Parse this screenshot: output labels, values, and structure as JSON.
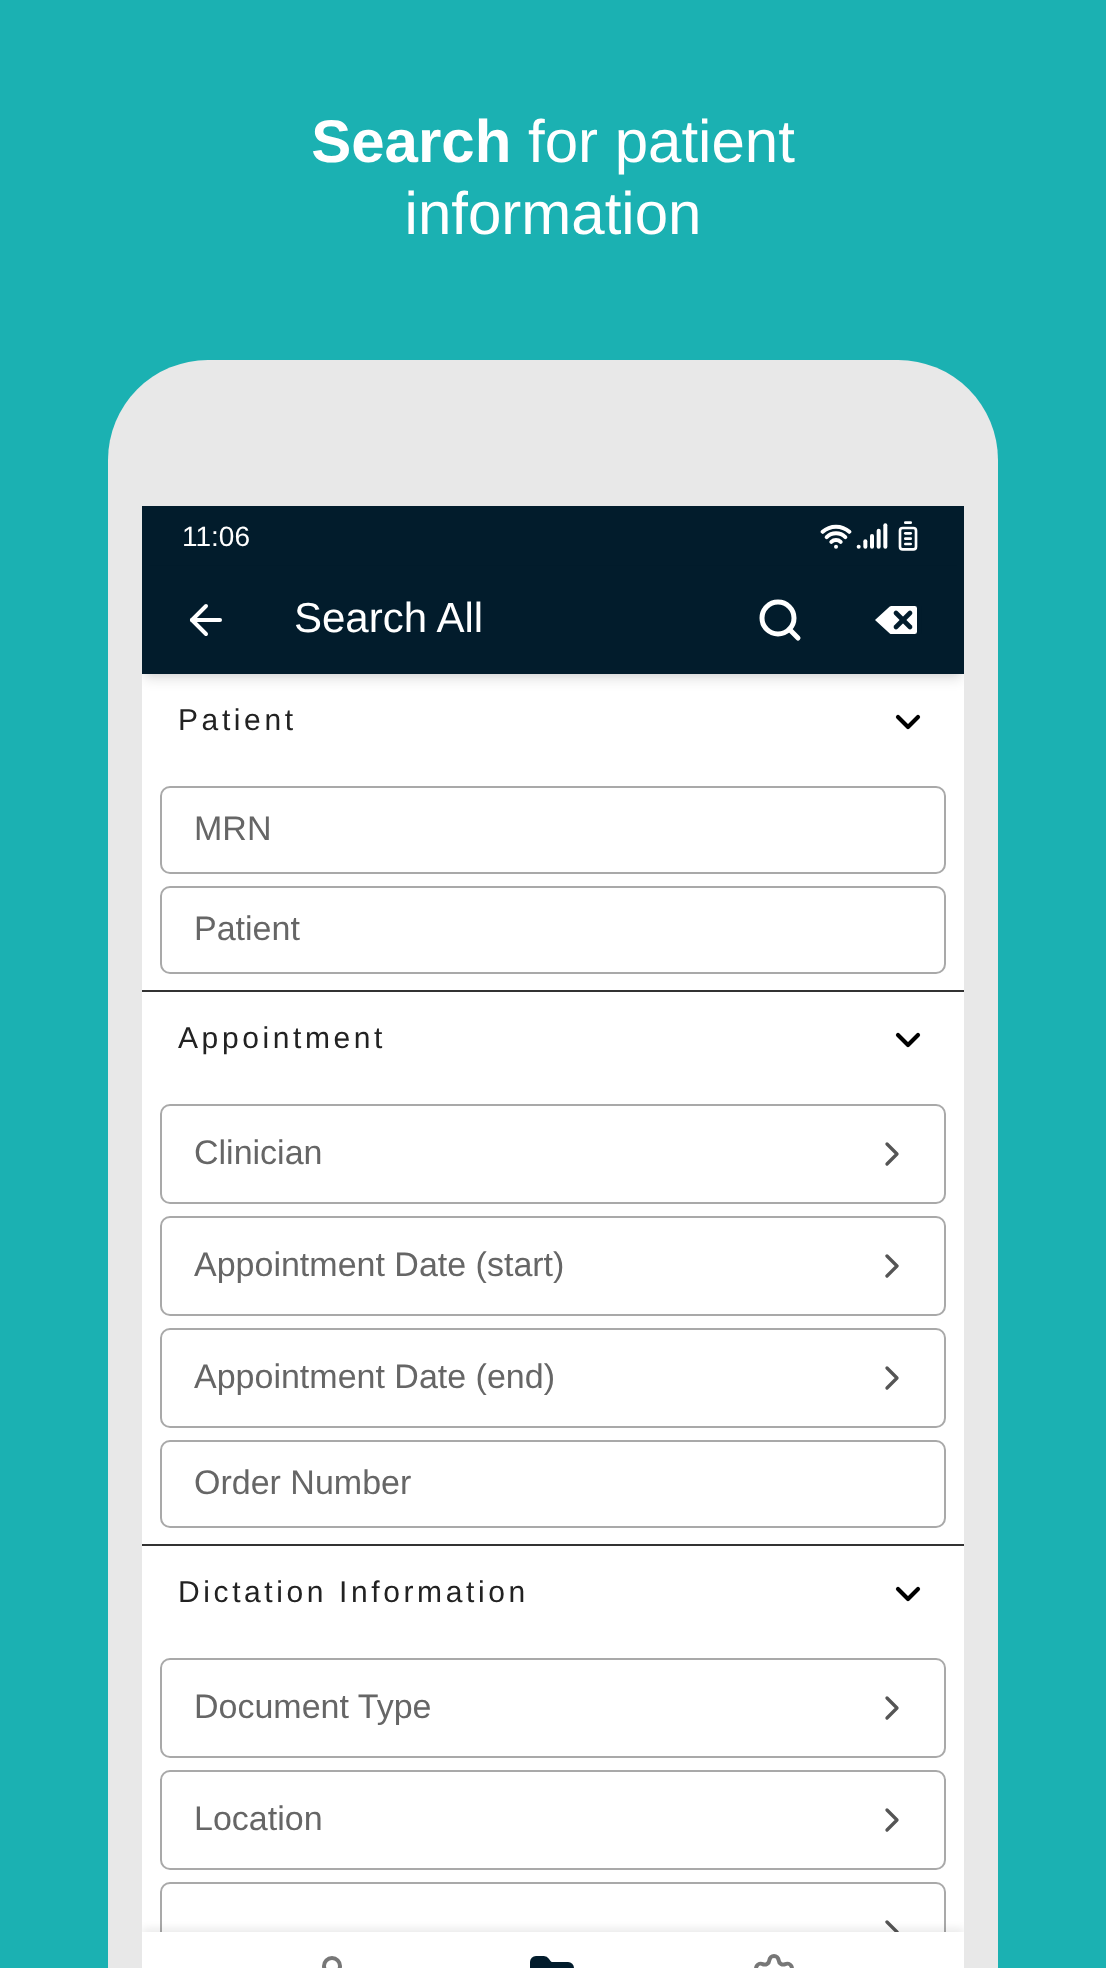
{
  "headline": "**Search** for patient information",
  "status_bar": {
    "time": "11:06"
  },
  "app_bar": {
    "title": "Search All"
  },
  "sections": [
    {
      "title": "Patient",
      "expanded": true,
      "fields": [
        {
          "kind": "text",
          "placeholder": "MRN"
        },
        {
          "kind": "text",
          "placeholder": "Patient"
        }
      ]
    },
    {
      "title": "Appointment",
      "expanded": true,
      "fields": [
        {
          "kind": "picker",
          "placeholder": "Clinician"
        },
        {
          "kind": "picker",
          "placeholder": "Appointment Date (start)"
        },
        {
          "kind": "picker",
          "placeholder": "Appointment Date (end)"
        },
        {
          "kind": "text",
          "placeholder": "Order Number"
        }
      ]
    },
    {
      "title": "Dictation Information",
      "expanded": true,
      "fields": [
        {
          "kind": "picker",
          "placeholder": "Document Type"
        },
        {
          "kind": "picker",
          "placeholder": "Location"
        },
        {
          "kind": "picker"
        }
      ]
    }
  ],
  "bottom_nav": [
    {
      "kind": "person",
      "selected": false
    },
    {
      "kind": "folder",
      "selected": true
    },
    {
      "kind": "gear",
      "selected": false
    }
  ]
}
